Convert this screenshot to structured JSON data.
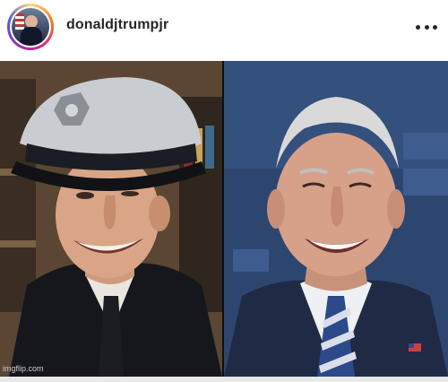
{
  "post": {
    "username": "donaldjtrumpjr",
    "watermark": "imgflip.com"
  },
  "icons": {
    "avatar": "profile-avatar",
    "more": "more-options-icon"
  },
  "colors": {
    "username": "#262626",
    "avatar_ring": [
      "#feda75",
      "#fa7e1e",
      "#d62976",
      "#962fbf",
      "#4f5bd5"
    ],
    "right_background": "#2f4870"
  }
}
